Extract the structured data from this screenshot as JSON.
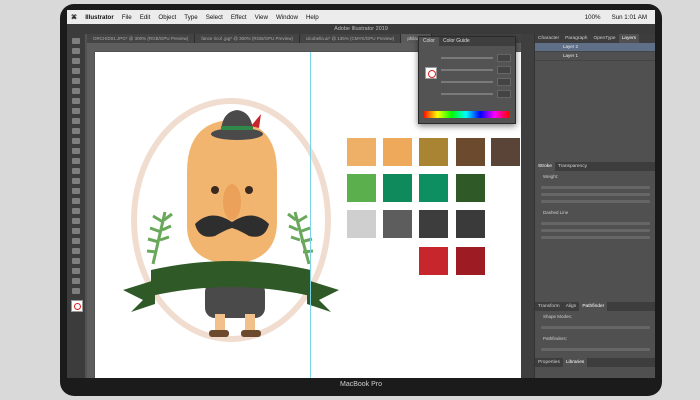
{
  "device": {
    "label": "MacBook Pro"
  },
  "menubar": {
    "apple": "",
    "items": [
      "Illustrator",
      "File",
      "Edit",
      "Object",
      "Type",
      "Select",
      "Effect",
      "View",
      "Window",
      "Help"
    ],
    "status": {
      "battery": "100%",
      "time": "Sun 1:01 AM"
    }
  },
  "app": {
    "title": "Adobe Illustrator 2019"
  },
  "tabs": [
    {
      "label": "ORCHID01.JPG* @ 300% (RGB/GPU Preview)"
    },
    {
      "label": "fance ricol .jpg* @ 300% (RGB/GPU Preview)"
    },
    {
      "label": "ulcobella.ai* @ 135% (CMYK/GPU Preview)"
    },
    {
      "label": "philadelp",
      "active": true
    }
  ],
  "color_panel": {
    "tabs": [
      "Color",
      "Color Guide"
    ]
  },
  "layers_panel": {
    "tabs": [
      "Character",
      "Paragraph",
      "OpenType",
      "Layers"
    ],
    "layers": [
      "Layer 2",
      "Layer 1"
    ]
  },
  "dock": {
    "panels": [
      "Stroke",
      "Transparency",
      "Pathfinder",
      "Align",
      "Properties",
      "Libraries"
    ],
    "stroke_label": "Weight:",
    "dashed": "Dashed Line",
    "pathfinder_label": "Shape Modes:",
    "pathfinders": "Pathfinders:"
  },
  "palette": {
    "rows": [
      [
        "#eeb067",
        "#eeaa5a",
        "#a98432",
        "#6b4a2e",
        "#5a4337"
      ],
      [
        "#5bb04d",
        "#0e8a5c",
        "#0e8f61",
        "#2f5a27"
      ],
      [
        "#cfcfcf",
        "#5d5d5d",
        "#3d3d3d",
        "#3a3a3a"
      ],
      [
        "#c8262d",
        "#9d1c24"
      ]
    ]
  },
  "colors": {
    "accent": "#f5f5f5"
  }
}
